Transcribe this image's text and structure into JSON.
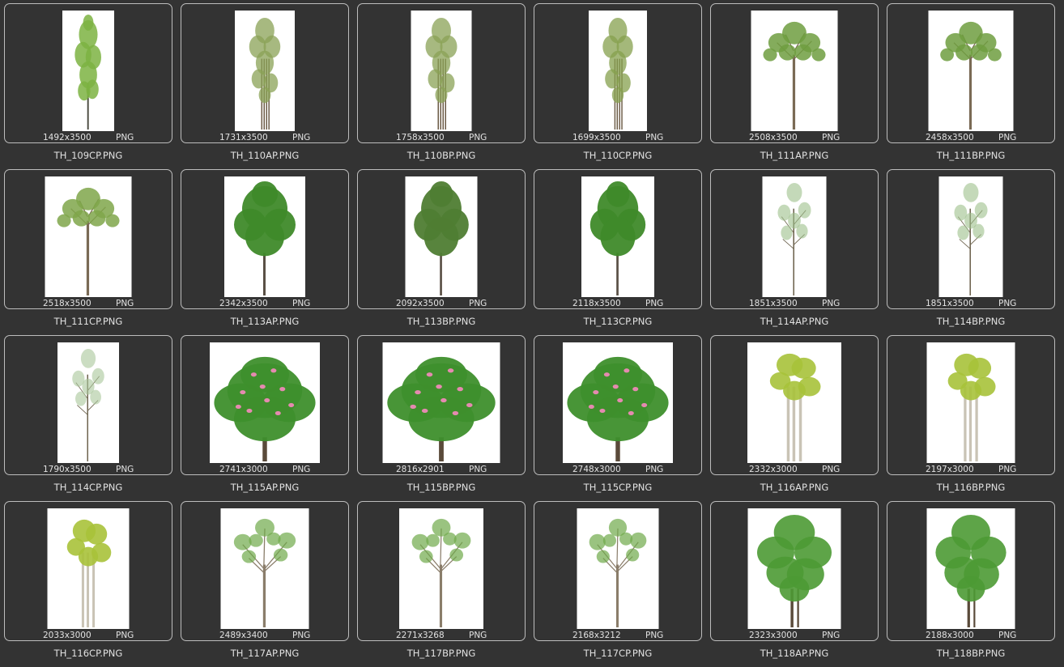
{
  "files": [
    {
      "name": "TH_109CP.PNG",
      "dims": "1492x3500",
      "format": "PNG",
      "tree": "tall-slim",
      "colors": {
        "leaf": "#7cb342",
        "trunk": "#4a4a40"
      }
    },
    {
      "name": "TH_110AP.PNG",
      "dims": "1731x3500",
      "format": "PNG",
      "tree": "multi-stem",
      "colors": {
        "leaf": "#8aa255",
        "trunk": "#6b5a45"
      }
    },
    {
      "name": "TH_110BP.PNG",
      "dims": "1758x3500",
      "format": "PNG",
      "tree": "multi-stem",
      "colors": {
        "leaf": "#8aa255",
        "trunk": "#6b5a45"
      }
    },
    {
      "name": "TH_110CP.PNG",
      "dims": "1699x3500",
      "format": "PNG",
      "tree": "multi-stem",
      "colors": {
        "leaf": "#86a04e",
        "trunk": "#6b5a45"
      }
    },
    {
      "name": "TH_111AP.PNG",
      "dims": "2508x3500",
      "format": "PNG",
      "tree": "umbrella",
      "colors": {
        "leaf": "#6f9d3f",
        "trunk": "#7a6a55"
      }
    },
    {
      "name": "TH_111BP.PNG",
      "dims": "2458x3500",
      "format": "PNG",
      "tree": "umbrella",
      "colors": {
        "leaf": "#6f9d3f",
        "trunk": "#7a6a55"
      }
    },
    {
      "name": "TH_111CP.PNG",
      "dims": "2518x3500",
      "format": "PNG",
      "tree": "umbrella",
      "colors": {
        "leaf": "#7fa64a",
        "trunk": "#7a6a55"
      }
    },
    {
      "name": "TH_113AP.PNG",
      "dims": "2342x3500",
      "format": "PNG",
      "tree": "round-dense",
      "colors": {
        "leaf": "#3f8a2a",
        "trunk": "#5a5045"
      }
    },
    {
      "name": "TH_113BP.PNG",
      "dims": "2092x3500",
      "format": "PNG",
      "tree": "round-dense",
      "colors": {
        "leaf": "#4f7d33",
        "trunk": "#5a5045"
      }
    },
    {
      "name": "TH_113CP.PNG",
      "dims": "2118x3500",
      "format": "PNG",
      "tree": "round-dense",
      "colors": {
        "leaf": "#3f8a2a",
        "trunk": "#5a5045"
      }
    },
    {
      "name": "TH_114AP.PNG",
      "dims": "1851x3500",
      "format": "PNG",
      "tree": "sparse",
      "colors": {
        "leaf": "#9cbf8a",
        "trunk": "#6f6550"
      }
    },
    {
      "name": "TH_114BP.PNG",
      "dims": "1851x3500",
      "format": "PNG",
      "tree": "sparse",
      "colors": {
        "leaf": "#9cbf8a",
        "trunk": "#6f6550"
      }
    },
    {
      "name": "TH_114CP.PNG",
      "dims": "1790x3500",
      "format": "PNG",
      "tree": "sparse",
      "colors": {
        "leaf": "#a9c79a",
        "trunk": "#6f6550"
      }
    },
    {
      "name": "TH_115AP.PNG",
      "dims": "2741x3000",
      "format": "PNG",
      "tree": "bush-flower",
      "colors": {
        "leaf": "#3e8f2c",
        "trunk": "#5a4a3a",
        "flower": "#e58ab0"
      }
    },
    {
      "name": "TH_115BP.PNG",
      "dims": "2816x2901",
      "format": "PNG",
      "tree": "bush-flower",
      "colors": {
        "leaf": "#3e8f2c",
        "trunk": "#5a4a3a",
        "flower": "#e58ab0"
      }
    },
    {
      "name": "TH_115CP.PNG",
      "dims": "2748x3000",
      "format": "PNG",
      "tree": "bush-flower",
      "colors": {
        "leaf": "#3e8f2c",
        "trunk": "#5a4a3a",
        "flower": "#e58ab0"
      }
    },
    {
      "name": "TH_116AP.PNG",
      "dims": "2332x3000",
      "format": "PNG",
      "tree": "birch",
      "colors": {
        "leaf": "#a7c23a",
        "trunk": "#c9c3b5"
      }
    },
    {
      "name": "TH_116BP.PNG",
      "dims": "2197x3000",
      "format": "PNG",
      "tree": "birch",
      "colors": {
        "leaf": "#a7c23a",
        "trunk": "#c9c3b5"
      }
    },
    {
      "name": "TH_116CP.PNG",
      "dims": "2033x3000",
      "format": "PNG",
      "tree": "birch",
      "colors": {
        "leaf": "#a9c23a",
        "trunk": "#c9c3b5"
      }
    },
    {
      "name": "TH_117AP.PNG",
      "dims": "2489x3400",
      "format": "PNG",
      "tree": "open-branch",
      "colors": {
        "leaf": "#6faa4a",
        "trunk": "#8a7d6a"
      }
    },
    {
      "name": "TH_117BP.PNG",
      "dims": "2271x3268",
      "format": "PNG",
      "tree": "open-branch",
      "colors": {
        "leaf": "#6faa4a",
        "trunk": "#8a7d6a"
      }
    },
    {
      "name": "TH_117CP.PNG",
      "dims": "2168x3212",
      "format": "PNG",
      "tree": "open-branch",
      "colors": {
        "leaf": "#6faa4a",
        "trunk": "#8a7d6a"
      }
    },
    {
      "name": "TH_118AP.PNG",
      "dims": "2323x3000",
      "format": "PNG",
      "tree": "broad-bush",
      "colors": {
        "leaf": "#4c9a34",
        "trunk": "#5a4a3a"
      }
    },
    {
      "name": "TH_118BP.PNG",
      "dims": "2188x3000",
      "format": "PNG",
      "tree": "broad-bush",
      "colors": {
        "leaf": "#4c9a34",
        "trunk": "#5a4a3a"
      }
    }
  ]
}
